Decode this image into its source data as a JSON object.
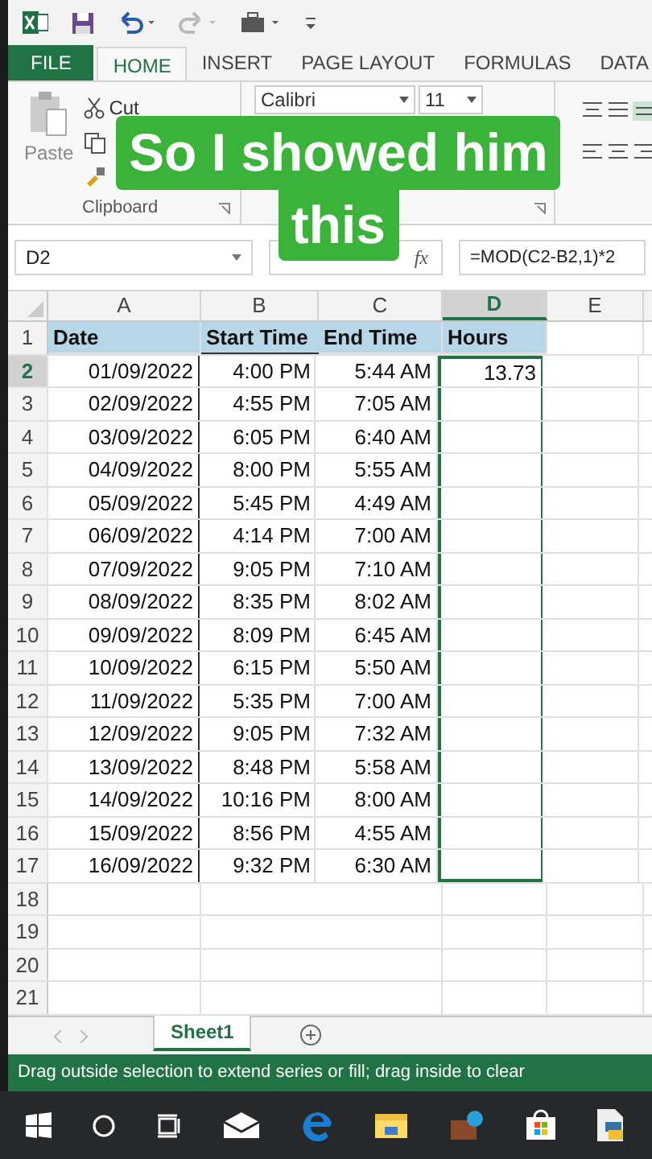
{
  "ribbon_tabs": [
    {
      "label": "FILE",
      "kind": "file",
      "selected": false
    },
    {
      "label": "HOME",
      "kind": "tab",
      "selected": true
    },
    {
      "label": "INSERT",
      "kind": "tab",
      "selected": false
    },
    {
      "label": "PAGE LAYOUT",
      "kind": "tab",
      "selected": false
    },
    {
      "label": "FORMULAS",
      "kind": "tab",
      "selected": false
    },
    {
      "label": "DATA",
      "kind": "tab",
      "selected": false
    }
  ],
  "clipboard": {
    "paste": "Paste",
    "cut": "Cut",
    "group": "Clipboard"
  },
  "font": {
    "name": "Calibri",
    "size": "11"
  },
  "caption": [
    "So I showed him",
    "this"
  ],
  "name_box": "D2",
  "function_label": "fx",
  "formula": "=MOD(C2-B2,1)*2",
  "columns": [
    {
      "label": "A",
      "selected": false
    },
    {
      "label": "B",
      "selected": false
    },
    {
      "label": "C",
      "selected": false
    },
    {
      "label": "D",
      "selected": true
    },
    {
      "label": "E",
      "selected": false
    }
  ],
  "rows": [
    {
      "number": "1",
      "active": false,
      "in_selection": false,
      "cells": [
        "Date",
        "Start Time",
        "End Time",
        "Hours"
      ]
    },
    {
      "number": "2",
      "active": true,
      "in_selection": true,
      "cells": [
        "01/09/2022",
        "4:00 PM",
        "5:44 AM",
        "13.73"
      ]
    },
    {
      "number": "3",
      "active": false,
      "in_selection": true,
      "cells": [
        "02/09/2022",
        "4:55 PM",
        "7:05 AM"
      ]
    },
    {
      "number": "4",
      "active": false,
      "in_selection": true,
      "cells": [
        "03/09/2022",
        "6:05 PM",
        "6:40 AM"
      ]
    },
    {
      "number": "5",
      "active": false,
      "in_selection": true,
      "cells": [
        "04/09/2022",
        "8:00 PM",
        "5:55 AM"
      ]
    },
    {
      "number": "6",
      "active": false,
      "in_selection": true,
      "cells": [
        "05/09/2022",
        "5:45 PM",
        "4:49 AM"
      ]
    },
    {
      "number": "7",
      "active": false,
      "in_selection": true,
      "cells": [
        "06/09/2022",
        "4:14 PM",
        "7:00 AM"
      ]
    },
    {
      "number": "8",
      "active": false,
      "in_selection": true,
      "cells": [
        "07/09/2022",
        "9:05 PM",
        "7:10 AM"
      ]
    },
    {
      "number": "9",
      "active": false,
      "in_selection": true,
      "cells": [
        "08/09/2022",
        "8:35 PM",
        "8:02 AM"
      ]
    },
    {
      "number": "10",
      "active": false,
      "in_selection": true,
      "cells": [
        "09/09/2022",
        "8:09 PM",
        "6:45 AM"
      ]
    },
    {
      "number": "11",
      "active": false,
      "in_selection": true,
      "cells": [
        "10/09/2022",
        "6:15 PM",
        "5:50 AM"
      ]
    },
    {
      "number": "12",
      "active": false,
      "in_selection": true,
      "cells": [
        "11/09/2022",
        "5:35 PM",
        "7:00 AM"
      ]
    },
    {
      "number": "13",
      "active": false,
      "in_selection": true,
      "cells": [
        "12/09/2022",
        "9:05 PM",
        "7:32 AM"
      ]
    },
    {
      "number": "14",
      "active": false,
      "in_selection": true,
      "cells": [
        "13/09/2022",
        "8:48 PM",
        "5:58 AM"
      ]
    },
    {
      "number": "15",
      "active": false,
      "in_selection": true,
      "cells": [
        "14/09/2022",
        "10:16 PM",
        "8:00 AM"
      ]
    },
    {
      "number": "16",
      "active": false,
      "in_selection": true,
      "cells": [
        "15/09/2022",
        "8:56 PM",
        "4:55 AM"
      ]
    },
    {
      "number": "17",
      "active": false,
      "in_selection": true,
      "cells": [
        "16/09/2022",
        "9:32 PM",
        "6:30 AM"
      ]
    },
    {
      "number": "18",
      "active": false,
      "in_selection": false,
      "cells": []
    },
    {
      "number": "19",
      "active": false,
      "in_selection": false,
      "cells": []
    },
    {
      "number": "20",
      "active": false,
      "in_selection": false,
      "cells": []
    },
    {
      "number": "21",
      "active": false,
      "in_selection": false,
      "cells": []
    }
  ],
  "sheet_tabs": [
    {
      "label": "Sheet1",
      "selected": true
    }
  ],
  "status_bar": "Drag outside selection to extend series or fill; drag inside to clear"
}
